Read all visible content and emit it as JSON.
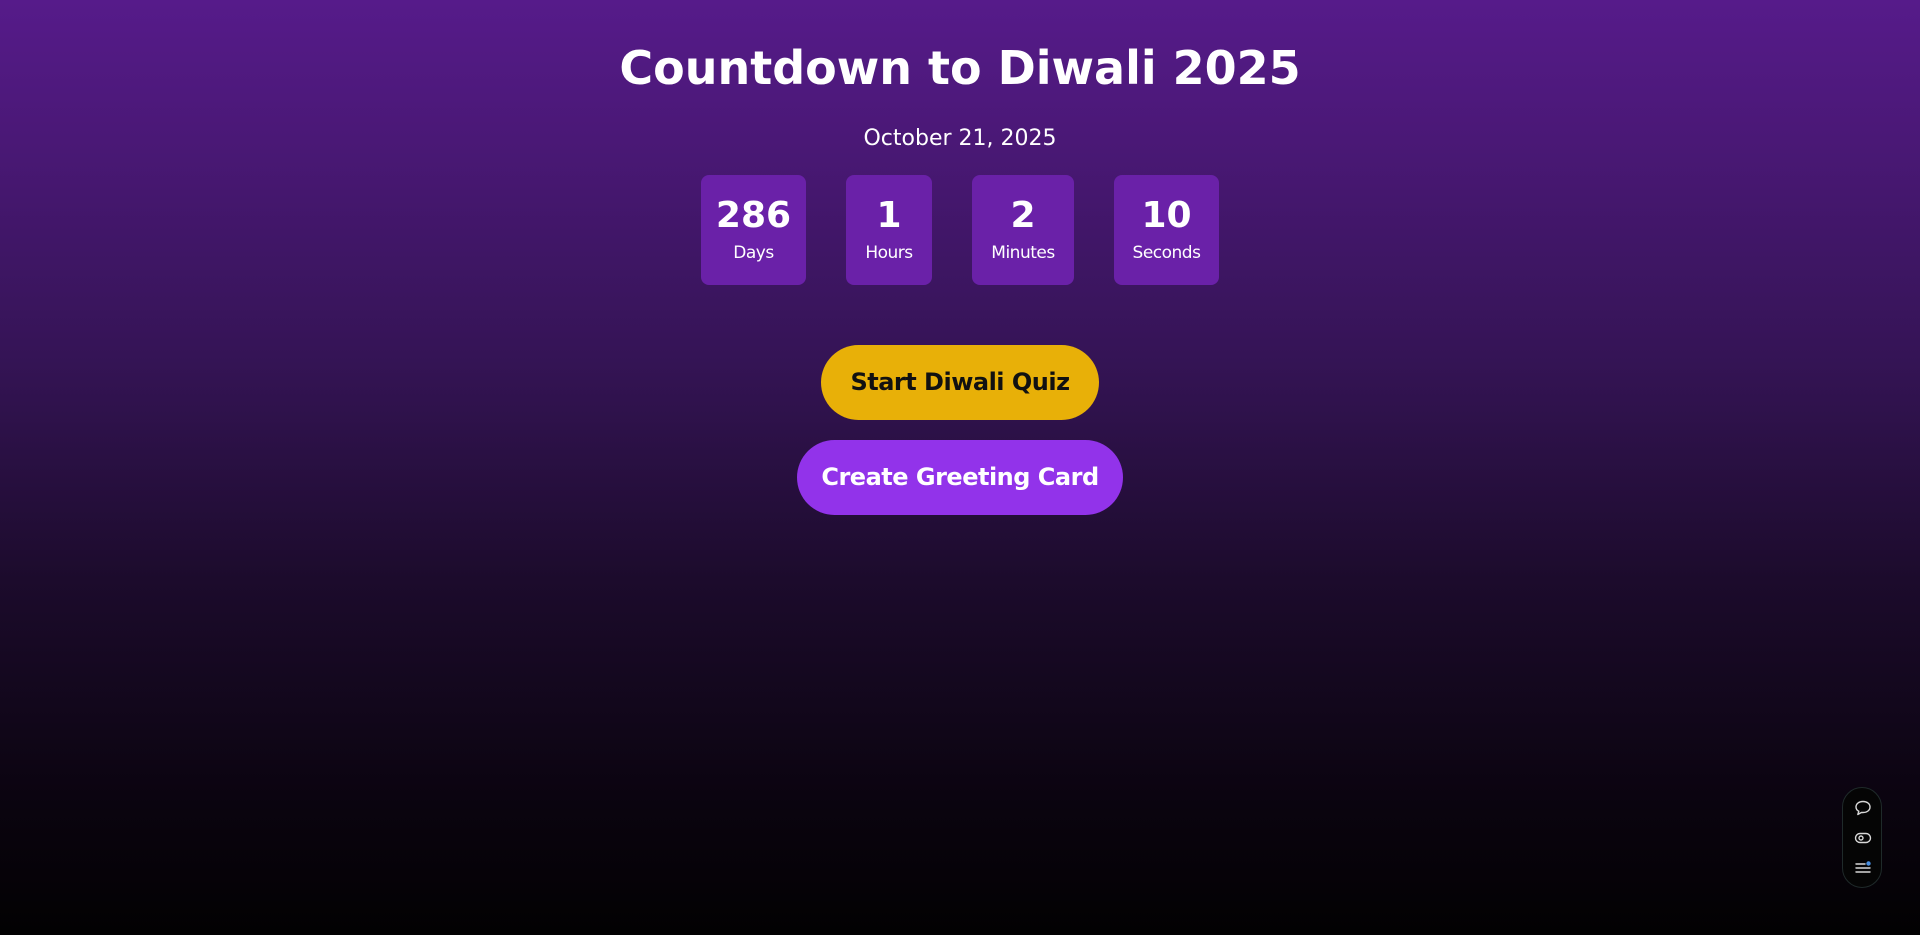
{
  "header": {
    "title": "Countdown to Diwali 2025",
    "date": "October 21, 2025"
  },
  "countdown": {
    "units": [
      {
        "value": "286",
        "label": "Days"
      },
      {
        "value": "1",
        "label": "Hours"
      },
      {
        "value": "2",
        "label": "Minutes"
      },
      {
        "value": "10",
        "label": "Seconds"
      }
    ]
  },
  "actions": {
    "quiz_label": "Start Diwali Quiz",
    "card_label": "Create Greeting Card"
  },
  "widget": {
    "icons": [
      "chat-bubble-icon",
      "eye-icon",
      "list-settings-icon"
    ]
  },
  "colors": {
    "background_top": "#561b8a",
    "background_bottom": "#020102",
    "countdown_box": "#6a21a8",
    "quiz_button": "#e8b008",
    "card_button": "#9233ea"
  }
}
